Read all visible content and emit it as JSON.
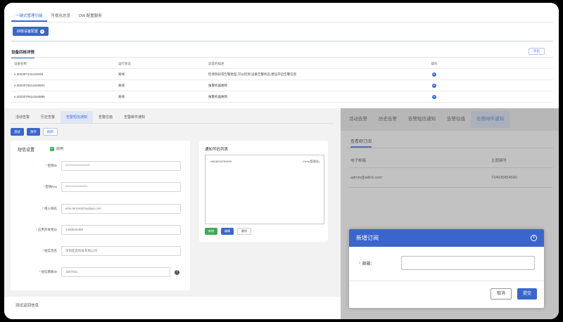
{
  "top": {
    "tabs": [
      {
        "label": "一键式管理功能"
      },
      {
        "label": "可视化总览"
      },
      {
        "label": "DW 配置服务"
      }
    ],
    "device_button": {
      "label": "四核设备配置",
      "icon": "plus-icon"
    },
    "section_title": "设备四核详情",
    "export_label": "导出",
    "table": {
      "headers": [
        "设备名称",
        "运行状态",
        "异常的描述",
        "操作"
      ],
      "rows": [
        {
          "name": "x-202307131419194",
          "status": "离线",
          "desc": "检测到异常告警类型,可以检测,设备告警状态,建议开启告警信息",
          "op_icon": "plus-icon"
        },
        {
          "name": "x-2023070614163921",
          "status": "离线",
          "desc": "报警机器故障",
          "op_icon": "plus-icon"
        },
        {
          "name": "x-2023070614164856",
          "status": "离线",
          "desc": "报警机器故障",
          "op_icon": "plus-icon"
        }
      ]
    }
  },
  "left": {
    "tabs": [
      {
        "label": "活动告警"
      },
      {
        "label": "历史告警"
      },
      {
        "label": "告警短信通知"
      },
      {
        "label": "告警估值"
      },
      {
        "label": "告警邮件通知"
      }
    ],
    "buttons": {
      "test": "测试",
      "save": "保存",
      "refresh": "刷新"
    },
    "sms": {
      "title": "短信设置",
      "enable_label": "启用",
      "fields": [
        {
          "label": "密钥ID",
          "value": "********************"
        },
        {
          "label": "密钥Key",
          "value": "******************"
        },
        {
          "label": "接入域名",
          "value": "sms.tencentcloudapi.com"
        },
        {
          "label": "应用开发者ID",
          "value": "1400845488"
        },
        {
          "label": "短信签名",
          "value": "深圳亚虎科技有限公司"
        },
        {
          "label": "短信模板ID",
          "value": "1557911"
        }
      ],
      "help_icon": "question-icon"
    },
    "numbers": {
      "title": "通知号码列表",
      "entries": [
        {
          "number": "+8618025789209",
          "name": "Chris(管理员)"
        }
      ],
      "buttons": {
        "add": "新增",
        "edit": "编辑",
        "delete": "删除"
      }
    },
    "bottom_label": "测试返回信息"
  },
  "right": {
    "tabs": [
      {
        "label": "活动告警"
      },
      {
        "label": "历史告警"
      },
      {
        "label": "告警短信通知"
      },
      {
        "label": "告警估值"
      },
      {
        "label": "告警邮件通知"
      }
    ],
    "subtab": "查看邮订阅",
    "headers": {
      "email": "电子邮箱",
      "phone": "主题编号"
    },
    "row": {
      "email": "admin@ailink.com",
      "phone": "734935854590"
    },
    "modal": {
      "title": "新增订阅",
      "field_label": "邮箱",
      "field_value": "",
      "cancel": "取消",
      "submit": "提交"
    }
  }
}
